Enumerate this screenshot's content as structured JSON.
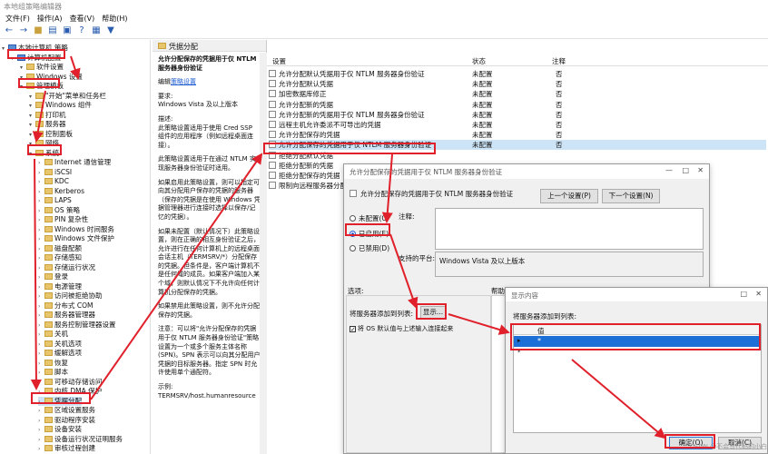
{
  "window": {
    "title": "本地组策略编辑器"
  },
  "menu": [
    "文件(F)",
    "操作(A)",
    "查看(V)",
    "帮助(H)"
  ],
  "tree": [
    {
      "label": "本地计算机 策略",
      "indent": 0,
      "icon": "computer-icon"
    },
    {
      "label": "计算机配置",
      "indent": 1,
      "icon": "computer-icon"
    },
    {
      "label": "软件设置",
      "indent": 2
    },
    {
      "label": "Windows 设置",
      "indent": 2
    },
    {
      "label": "管理模板",
      "indent": 2
    },
    {
      "label": "\"开始\"菜单和任务栏",
      "indent": 3
    },
    {
      "label": "Windows 组件",
      "indent": 3
    },
    {
      "label": "打印机",
      "indent": 3
    },
    {
      "label": "服务器",
      "indent": 3
    },
    {
      "label": "控制面板",
      "indent": 3
    },
    {
      "label": "网络",
      "indent": 3
    },
    {
      "label": "系统",
      "indent": 3
    },
    {
      "label": "Internet 通信管理",
      "indent": 4
    },
    {
      "label": "iSCSI",
      "indent": 4
    },
    {
      "label": "KDC",
      "indent": 4
    },
    {
      "label": "Kerberos",
      "indent": 4
    },
    {
      "label": "LAPS",
      "indent": 4
    },
    {
      "label": "OS 策略",
      "indent": 4
    },
    {
      "label": "PIN 复杂性",
      "indent": 4
    },
    {
      "label": "Windows 时间服务",
      "indent": 4
    },
    {
      "label": "Windows 文件保护",
      "indent": 4
    },
    {
      "label": "磁盘配额",
      "indent": 4
    },
    {
      "label": "存储感知",
      "indent": 4
    },
    {
      "label": "存储运行状况",
      "indent": 4
    },
    {
      "label": "登录",
      "indent": 4
    },
    {
      "label": "电源管理",
      "indent": 4
    },
    {
      "label": "访问被拒绝协助",
      "indent": 4
    },
    {
      "label": "分布式 COM",
      "indent": 4
    },
    {
      "label": "服务器管理器",
      "indent": 4
    },
    {
      "label": "服务控制管理器设置",
      "indent": 4
    },
    {
      "label": "关机",
      "indent": 4
    },
    {
      "label": "关机选项",
      "indent": 4
    },
    {
      "label": "缓解选项",
      "indent": 4
    },
    {
      "label": "恢复",
      "indent": 4
    },
    {
      "label": "脚本",
      "indent": 4
    },
    {
      "label": "可移动存储访问",
      "indent": 4
    },
    {
      "label": "内核 DMA 保护",
      "indent": 4
    },
    {
      "label": "凭据分配",
      "indent": 4
    },
    {
      "label": "区域设置服务",
      "indent": 4
    },
    {
      "label": "驱动程序安装",
      "indent": 4
    },
    {
      "label": "设备安装",
      "indent": 4
    },
    {
      "label": "设备运行状况证明服务",
      "indent": 4
    },
    {
      "label": "审核过程创建",
      "indent": 4
    }
  ],
  "desc": {
    "header": "凭据分配",
    "title": "允许分配保存的凭据用于仅 NTLM 服务器身份验证",
    "edit_prefix": "编辑",
    "edit_link": "策略设置",
    "req_label": "要求:",
    "req_value": "Windows Vista 及以上版本",
    "desc_label": "描述:",
    "p1": "此策略设置适用于使用 Cred SSP 组件的应用程序（例如远程桌面连接）。",
    "p2": "此策略设置适用于在通过 NTLM 实现服务器身份验证时适用。",
    "p3": "如果启用此策略设置，则可以指定可向其分配用户保存的凭据的服务器（保存的凭据是在使用 Windows 凭据管理器进行连接时选择以保存/记忆的凭据）。",
    "p4": "如果未配置（默认情况下）此策略设置，则在正确的相互身份验证之后，允许进行在任何计算机上的远程桌面会话主机（TERMSRV/*）分配保存的凭据。但条件是，客户端计算机不是任何域的成员。如果客户端加入某个域，则默认情况下不允许向任何计算机分配保存的凭据。",
    "p5": "如果禁用此策略设置，则不允许分配保存的凭据。",
    "p6": "注意：可以将\"允许分配保存的凭据用于仅 NTLM 服务器身份验证\"策略设置为一个或多个服务主体名称(SPN)。SPN 表示可以向其分配用户凭据的目标服务器。指定 SPN 时允许使用单个通配符。",
    "p7": "示例:",
    "p8": "TERMSRV/host.humanresource"
  },
  "list": {
    "columns": [
      "设置",
      "状态",
      "注释"
    ],
    "rows": [
      {
        "name": "允许分配默认凭据用于仅 NTLM 服务器身份验证",
        "state": "未配置",
        "note": "否"
      },
      {
        "name": "允许分配默认凭据",
        "state": "未配置",
        "note": "否"
      },
      {
        "name": "加密数据库修正",
        "state": "未配置",
        "note": "否"
      },
      {
        "name": "允许分配新的凭据",
        "state": "未配置",
        "note": "否"
      },
      {
        "name": "允许分配新的凭据用于仅 NTLM 服务器身份验证",
        "state": "未配置",
        "note": "否"
      },
      {
        "name": "远程主机允许委派不可导出的凭据",
        "state": "未配置",
        "note": "否"
      },
      {
        "name": "允许分配保存的凭据",
        "state": "未配置",
        "note": "否"
      },
      {
        "name": "允许分配保存的凭据用于仅 NTLM 服务器身份验证",
        "state": "未配置",
        "note": "否"
      },
      {
        "name": "拒绝分配默认凭据",
        "state": "",
        "note": ""
      },
      {
        "name": "拒绝分配新的凭据",
        "state": "",
        "note": ""
      },
      {
        "name": "拒绝分配保存的凭据",
        "state": "",
        "note": ""
      },
      {
        "name": "限制向远程服务器分配凭据",
        "state": "",
        "note": ""
      }
    ]
  },
  "dlg1": {
    "title": "允许分配保存的凭据用于仅 NTLM 服务器身份验证",
    "heading": "允许分配保存的凭据用于仅 NTLM 服务器身份验证",
    "prev": "上一个设置(P)",
    "next": "下一个设置(N)",
    "opt_unconfigured": "未配置(C)",
    "opt_enabled": "已启用(E)",
    "opt_disabled": "已禁用(D)",
    "note_label": "注释:",
    "platform_label": "支持的平台:",
    "platform_value": "Windows Vista 及以上版本",
    "options_label": "选项:",
    "help_label": "帮助:",
    "add_servers": "将服务器添加到列表:",
    "show_btn": "显示...",
    "concat": "将 OS 默认值与上述输入连接起来"
  },
  "dlg2": {
    "title": "显示内容",
    "subtitle": "将服务器添加到列表:",
    "col_value": "值",
    "row1": "*",
    "ok": "确定(O)",
    "cancel": "取消(C)"
  },
  "watermark": "CSDN @不会写代码的小白"
}
